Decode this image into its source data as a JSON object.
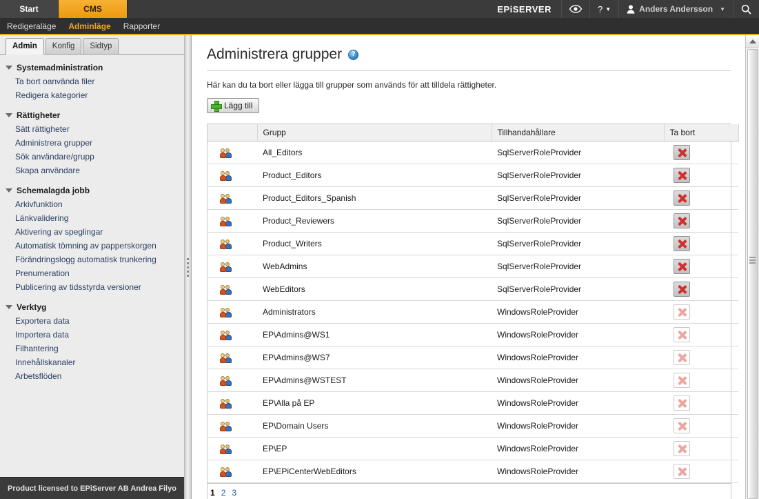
{
  "topbar": {
    "tabs": [
      {
        "label": "Start",
        "active": false
      },
      {
        "label": "CMS",
        "active": true
      }
    ],
    "brand": "EPiSERVER",
    "view_icon": "eye-icon",
    "help_icon": "question-mark-icon",
    "user_name": "Anders Andersson",
    "user_icon": "person-icon",
    "search_icon": "search-icon",
    "accent_color": "#f0a81e"
  },
  "subnav": {
    "items": [
      {
        "label": "Redigeraläge",
        "active": false
      },
      {
        "label": "Adminläge",
        "active": true
      },
      {
        "label": "Rapporter",
        "active": false
      }
    ]
  },
  "sidebar": {
    "tabs": [
      {
        "label": "Admin",
        "active": true
      },
      {
        "label": "Konfig",
        "active": false
      },
      {
        "label": "Sidtyp",
        "active": false
      }
    ],
    "groups": [
      {
        "title": "Systemadministration",
        "items": [
          "Ta bort oanvända filer",
          "Redigera kategorier"
        ]
      },
      {
        "title": "Rättigheter",
        "items": [
          "Sätt rättigheter",
          "Administrera grupper",
          "Sök användare/grupp",
          "Skapa användare"
        ]
      },
      {
        "title": "Schemalagda jobb",
        "items": [
          "Arkivfunktion",
          "Länkvalidering",
          "Aktivering av speglingar",
          "Automatisk tömning av papperskorgen",
          "Förändringslogg automatisk trunkering",
          "Prenumeration",
          "Publicering av tidsstyrda versioner"
        ]
      },
      {
        "title": "Verktyg",
        "items": [
          "Exportera data",
          "Importera data",
          "Filhantering",
          "Innehållskanaler",
          "Arbetsflöden"
        ]
      }
    ],
    "footer": "Product licensed to EPiServer AB Andrea Filyo"
  },
  "main": {
    "title": "Administrera grupper",
    "help_icon": "help-icon",
    "description": "Här kan du ta bort eller lägga till grupper som används för att tilldela rättigheter.",
    "add_button": "Lägg till",
    "columns": [
      "",
      "Grupp",
      "Tillhandahållare",
      "Ta bort"
    ],
    "rows": [
      {
        "group": "All_Editors",
        "provider": "SqlServerRoleProvider",
        "deletable": true
      },
      {
        "group": "Product_Editors",
        "provider": "SqlServerRoleProvider",
        "deletable": true
      },
      {
        "group": "Product_Editors_Spanish",
        "provider": "SqlServerRoleProvider",
        "deletable": true
      },
      {
        "group": "Product_Reviewers",
        "provider": "SqlServerRoleProvider",
        "deletable": true
      },
      {
        "group": "Product_Writers",
        "provider": "SqlServerRoleProvider",
        "deletable": true
      },
      {
        "group": "WebAdmins",
        "provider": "SqlServerRoleProvider",
        "deletable": true
      },
      {
        "group": "WebEditors",
        "provider": "SqlServerRoleProvider",
        "deletable": true
      },
      {
        "group": "Administrators",
        "provider": "WindowsRoleProvider",
        "deletable": false
      },
      {
        "group": "EP\\Admins@WS1",
        "provider": "WindowsRoleProvider",
        "deletable": false
      },
      {
        "group": "EP\\Admins@WS7",
        "provider": "WindowsRoleProvider",
        "deletable": false
      },
      {
        "group": "EP\\Admins@WSTEST",
        "provider": "WindowsRoleProvider",
        "deletable": false
      },
      {
        "group": "EP\\Alla på EP",
        "provider": "WindowsRoleProvider",
        "deletable": false
      },
      {
        "group": "EP\\Domain Users",
        "provider": "WindowsRoleProvider",
        "deletable": false
      },
      {
        "group": "EP\\EP",
        "provider": "WindowsRoleProvider",
        "deletable": false
      },
      {
        "group": "EP\\EPiCenterWebEditors",
        "provider": "WindowsRoleProvider",
        "deletable": false
      }
    ],
    "pages": [
      {
        "label": "1",
        "active": true
      },
      {
        "label": "2",
        "active": false
      },
      {
        "label": "3",
        "active": false
      }
    ]
  }
}
